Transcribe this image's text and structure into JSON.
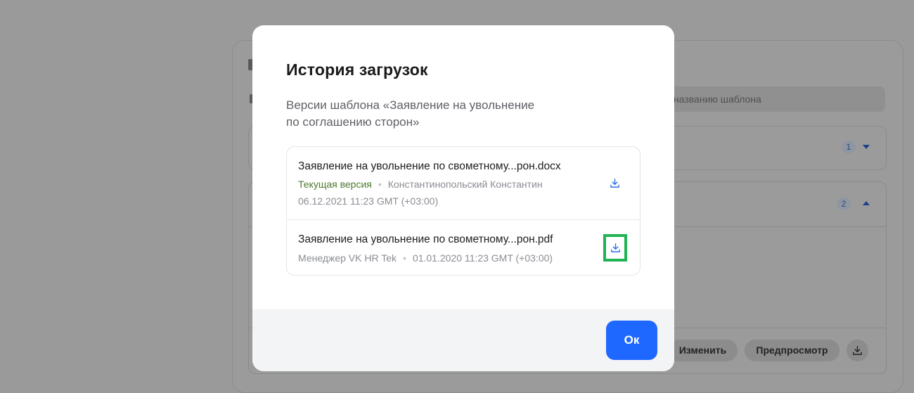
{
  "background": {
    "search_placeholder": "названию шаблона",
    "group1_count": "1",
    "group2_count": "2",
    "edit_label": "Изменить",
    "preview_label": "Предпросмотр",
    "download_icon": "download-icon"
  },
  "modal": {
    "title": "История загрузок",
    "subtitle_line1": "Версии шаблона «Заявление на увольнение",
    "subtitle_line2": "по соглашению сторон»",
    "files": [
      {
        "name": "Заявление на увольнение по свометному...рон.docx",
        "status": "Текущая версия",
        "author": "Константинопольский Константин",
        "date": "06.12.2021 11:23 GMT (+03:00)"
      },
      {
        "name": "Заявление на увольнение по свометному...рон.pdf",
        "author": "Менеджер VK HR Tek",
        "date": "01.01.2020 11:23 GMT (+03:00)"
      }
    ],
    "ok_label": "Ок"
  },
  "colors": {
    "accent": "#1f68ff",
    "current_version": "#4c7a2e",
    "highlight": "#21b354"
  }
}
